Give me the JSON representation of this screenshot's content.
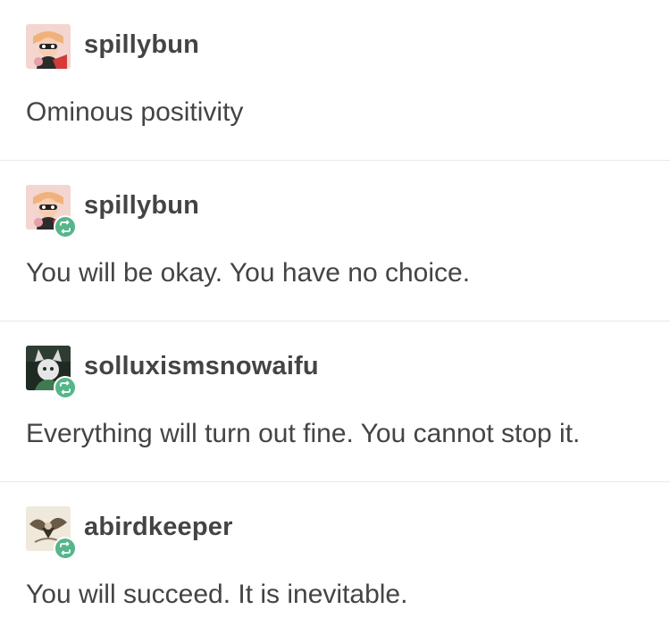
{
  "posts": [
    {
      "username": "spillybun",
      "text": "Ominous positivity",
      "avatar_icon": "spillybun-avatar-icon",
      "reblog": false
    },
    {
      "username": "spillybun",
      "text": "You will be okay. You have no choice.",
      "avatar_icon": "spillybun-avatar-icon",
      "reblog": true
    },
    {
      "username": "solluxismsnowaifu",
      "text": "Everything will turn out fine. You cannot stop it.",
      "avatar_icon": "solluxismsnowaifu-avatar-icon",
      "reblog": true
    },
    {
      "username": "abirdkeeper",
      "text": "You will succeed. It is inevitable.",
      "avatar_icon": "abirdkeeper-avatar-icon",
      "reblog": true
    }
  ],
  "colors": {
    "text": "#444444",
    "divider": "#e9e9e9",
    "reblog_badge": "#55b689",
    "background": "#ffffff"
  }
}
